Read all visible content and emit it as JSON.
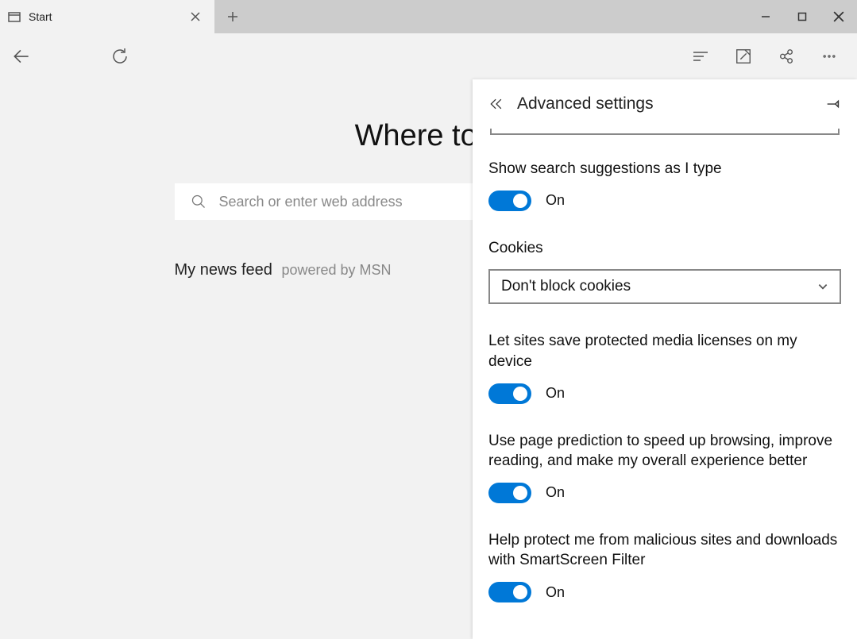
{
  "tab": {
    "title": "Start"
  },
  "page": {
    "headline": "Where to n",
    "search_placeholder": "Search or enter web address",
    "feed_title": "My news feed",
    "feed_sub": "powered by MSN"
  },
  "panel": {
    "title": "Advanced settings",
    "settings": {
      "search_suggestions": {
        "label": "Show search suggestions as I type",
        "state": "On"
      },
      "cookies": {
        "label": "Cookies",
        "value": "Don't block cookies"
      },
      "media_licenses": {
        "label": "Let sites save protected media licenses on my device",
        "state": "On"
      },
      "page_prediction": {
        "label": "Use page prediction to speed up browsing, improve reading, and make my overall experience better",
        "state": "On"
      },
      "smartscreen": {
        "label": "Help protect me from malicious sites and downloads with SmartScreen Filter",
        "state": "On"
      }
    }
  }
}
